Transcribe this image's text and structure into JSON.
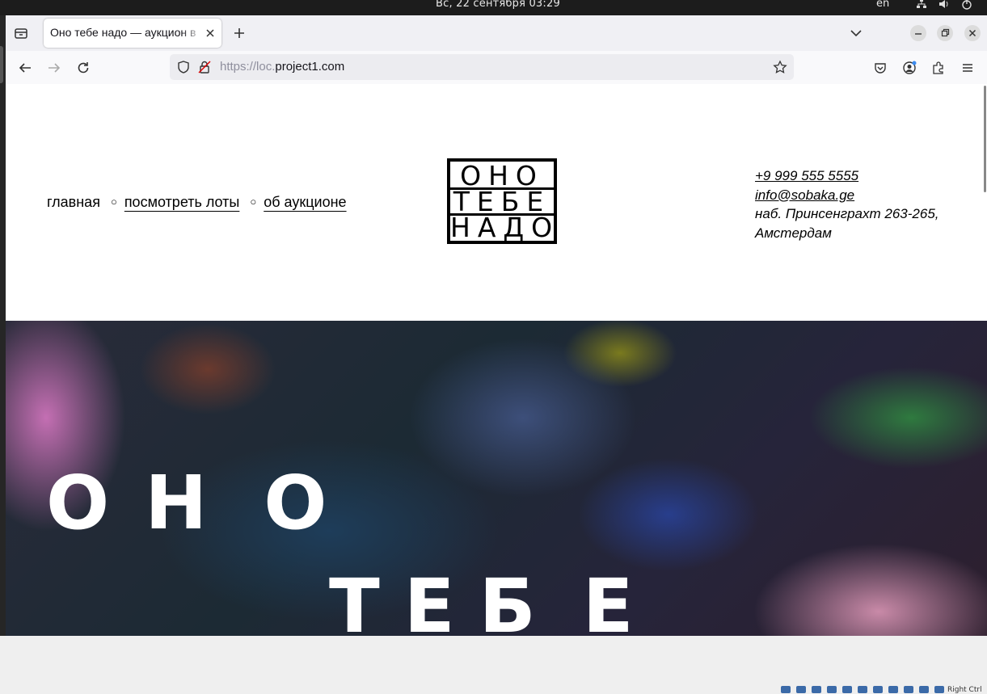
{
  "os": {
    "clock": "Вс, 22 сентября  03:29",
    "language": "en",
    "tray_text": "Right Ctrl"
  },
  "browser": {
    "tab_title": "Оно тебе надо — аукцион в",
    "url_scheme": "https://loc.",
    "url_host": "project1.com"
  },
  "site": {
    "nav": [
      {
        "label": "главная"
      },
      {
        "label": "посмотреть лоты"
      },
      {
        "label": "об аукционе"
      }
    ],
    "nav_separator": "○",
    "logo_rows": [
      "ОНО",
      "ТЕБЕ",
      "НАДО"
    ],
    "contacts": {
      "phone": "+9 999 555 5555",
      "email": "info@sobaka.ge",
      "address_line1": "наб. Принсенграхт 263-265,",
      "address_line2": "Амстердам"
    },
    "hero": {
      "line1": [
        "О",
        "Н",
        "О"
      ],
      "line2": [
        "Т",
        "Е",
        "Б",
        "Е"
      ]
    }
  }
}
